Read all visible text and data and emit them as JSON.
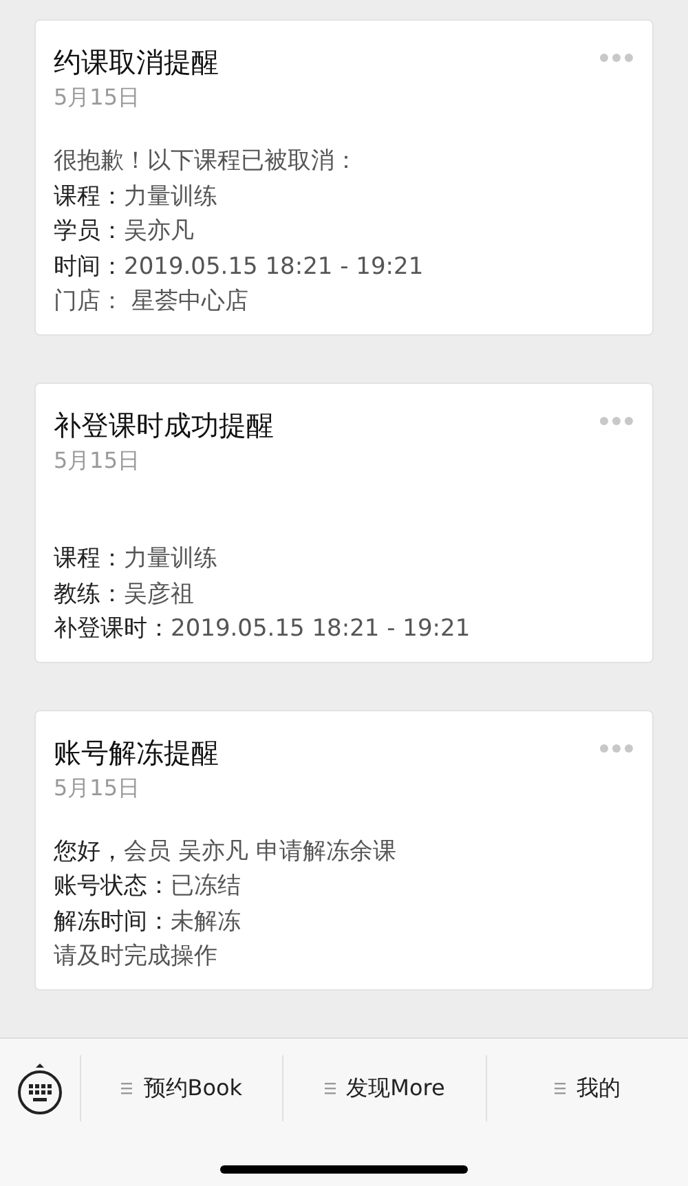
{
  "messages": [
    {
      "title": "约课取消提醒",
      "date": "5月15日",
      "lines": [
        {
          "kind": "note",
          "text": "很抱歉！以下课程已被取消："
        },
        {
          "kind": "field",
          "label": "课程：",
          "value": "力量训练"
        },
        {
          "kind": "field",
          "label": "学员：",
          "value": "吴亦凡"
        },
        {
          "kind": "field",
          "label": "时间：",
          "value": "2019.05.15 18:21 - 19:21"
        },
        {
          "kind": "note",
          "text": "门店：  星荟中心店"
        }
      ]
    },
    {
      "title": "补登课时成功提醒",
      "date": "5月15日",
      "lines": [
        {
          "kind": "blank"
        },
        {
          "kind": "field",
          "label": "课程：",
          "value": "力量训练"
        },
        {
          "kind": "field",
          "label": "教练：",
          "value": "吴彦祖"
        },
        {
          "kind": "field",
          "label": "补登课时：",
          "value": "2019.05.15 18:21 - 19:21"
        }
      ]
    },
    {
      "title": "账号解冻提醒",
      "date": "5月15日",
      "lines": [
        {
          "kind": "field",
          "label": "您好，",
          "value": "会员 吴亦凡 申请解冻余课"
        },
        {
          "kind": "field",
          "label": "账号状态：",
          "value": "已冻结"
        },
        {
          "kind": "field",
          "label": "解冻时间：",
          "value": "未解冻"
        },
        {
          "kind": "note",
          "text": "请及时完成操作"
        }
      ]
    }
  ],
  "menu": [
    {
      "label": "预约Book"
    },
    {
      "label": "发现More"
    },
    {
      "label": "我的"
    }
  ]
}
